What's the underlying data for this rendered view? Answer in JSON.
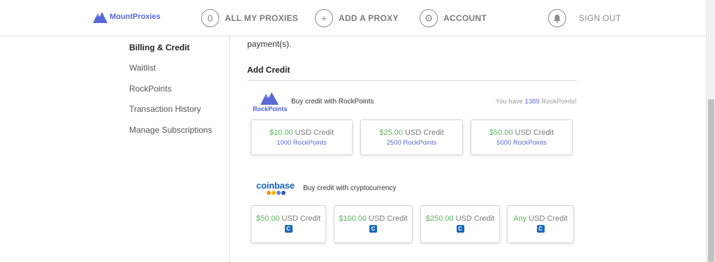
{
  "header": {
    "brand": "MountProxies",
    "nav": [
      {
        "glyph": "0",
        "label": "ALL MY PROXIES"
      },
      {
        "glyph": "+",
        "label": "ADD A PROXY"
      },
      {
        "glyph": "⚙",
        "label": "ACCOUNT"
      }
    ],
    "sign_out": "SIGN OUT"
  },
  "sidebar": {
    "items": [
      {
        "label": "Billing & Credit",
        "active": true
      },
      {
        "label": "Waitlist"
      },
      {
        "label": "RockPoints"
      },
      {
        "label": "Transaction History"
      },
      {
        "label": "Manage Subscriptions"
      }
    ]
  },
  "main": {
    "partial_text": "payment(s).",
    "section_title": "Add Credit",
    "rockpoints": {
      "logo_text": "RockPoints",
      "title": "Buy credit with RockPoints",
      "balance_prefix": "You have ",
      "balance_value": "1389",
      "balance_suffix": " RockPoints!",
      "options": [
        {
          "amount": "$10.00",
          "unit": " USD Credit",
          "points": "1000 RockPoints"
        },
        {
          "amount": "$25.00",
          "unit": " USD Credit",
          "points": "2500 RockPoints"
        },
        {
          "amount": "$50.00",
          "unit": " USD Credit",
          "points": "5000 RockPoints"
        }
      ]
    },
    "coinbase": {
      "logo_text": "coinbase",
      "title": "Buy credit with cryptocurrency",
      "badge": "C",
      "options": [
        {
          "amount": "$50.00",
          "unit": " USD Credit"
        },
        {
          "amount": "$100.00",
          "unit": " USD Credit"
        },
        {
          "amount": "$250.00",
          "unit": " USD Credit"
        },
        {
          "amount": "Any",
          "unit": " USD Credit"
        }
      ]
    }
  },
  "colors": {
    "brand": "#5b68d9",
    "green": "#5bb85b",
    "coinbase_blue": "#1a63c2"
  }
}
